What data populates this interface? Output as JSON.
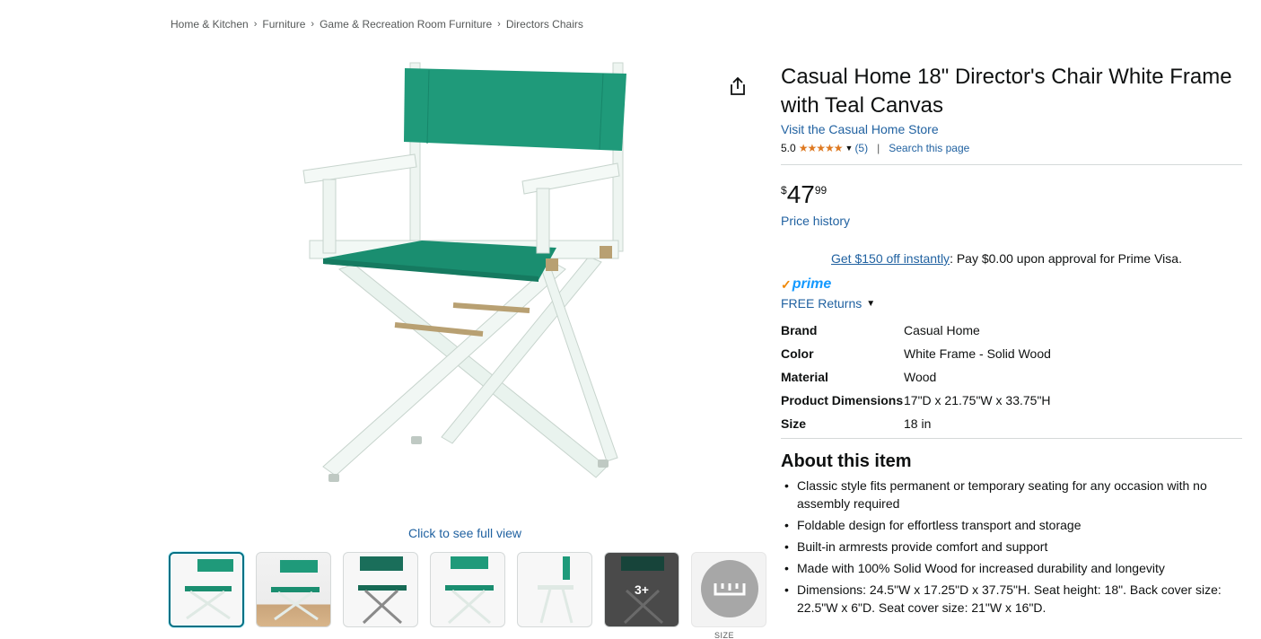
{
  "breadcrumb": [
    "Home & Kitchen",
    "Furniture",
    "Game & Recreation Room Furniture",
    "Directors Chairs"
  ],
  "breadcrumb_sep": "›",
  "gallery": {
    "full_view_label": "Click to see full view",
    "more_label": "3+",
    "size_label": "SIZE"
  },
  "product": {
    "title": "Casual Home 18\" Director's Chair White Frame with Teal Canvas",
    "store_link": "Visit the Casual Home Store",
    "rating_value": "5.0",
    "stars": 5,
    "review_count": "(5)",
    "search_page": "Search this page",
    "price_symbol": "$",
    "price_whole": "47",
    "price_fraction": "99",
    "price_history": "Price history",
    "promo_link": "Get $150 off instantly",
    "promo_text": ": Pay $0.00 upon approval for Prime Visa.",
    "prime_check": "✓",
    "prime_label": "prime",
    "returns_label": "FREE Returns"
  },
  "specs": [
    {
      "key": "Brand",
      "value": "Casual Home"
    },
    {
      "key": "Color",
      "value": "White Frame - Solid Wood"
    },
    {
      "key": "Material",
      "value": "Wood"
    },
    {
      "key": "Product Dimensions",
      "value": "17\"D x 21.75\"W x 33.75\"H"
    },
    {
      "key": "Size",
      "value": "18 in"
    }
  ],
  "about": {
    "title": "About this item",
    "bullets": [
      "Classic style fits permanent or temporary seating for any occasion with no assembly required",
      "Foldable design for effortless transport and storage",
      "Built-in armrests provide comfort and support",
      "Made with 100% Solid Wood for increased durability and longevity",
      "Dimensions: 24.5\"W x 17.25\"D x 37.75\"H. Seat height: 18\". Back cover size: 22.5\"W x 6\"D. Seat cover size: 21\"W x 16\"D."
    ]
  },
  "colors": {
    "link": "#2162a1",
    "star": "#de7921",
    "prime_blue": "#1399ff",
    "canvas_teal": "#1f9a7a"
  }
}
